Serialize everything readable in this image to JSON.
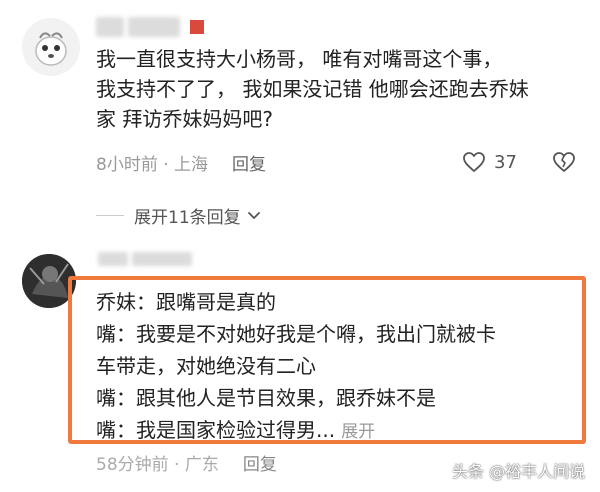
{
  "comments": [
    {
      "lines": [
        "我一直很支持大小杨哥，  唯有对嘴哥这个事，",
        "我支持不了了，  我如果没记错 他哪会还跑去乔妹",
        "家  拜访乔妹妈妈吧?"
      ],
      "time_location": "8小时前 · 上海",
      "reply_label": "回复",
      "like_count": "37",
      "expand_replies": "展开11条回复"
    },
    {
      "lines": [
        "乔妹：跟嘴哥是真的",
        "嘴：我要是不对她好我是个嘚，我出门就被卡",
        "车带走，对她绝没有二心",
        "嘴：跟其他人是节目效果，跟乔妹不是",
        "嘴：我是国家检验过得男..."
      ],
      "expand_inline": "展开",
      "time_location": "58分钟前 · 广东",
      "reply_label": "回复"
    }
  ],
  "colors": {
    "highlight_border": "#f07a3c",
    "badge_red": "#d94a3c"
  },
  "icons": [
    "heart-icon",
    "broken-heart-icon",
    "chevron-down-icon"
  ],
  "watermark": "头条 @裕丰人间说"
}
